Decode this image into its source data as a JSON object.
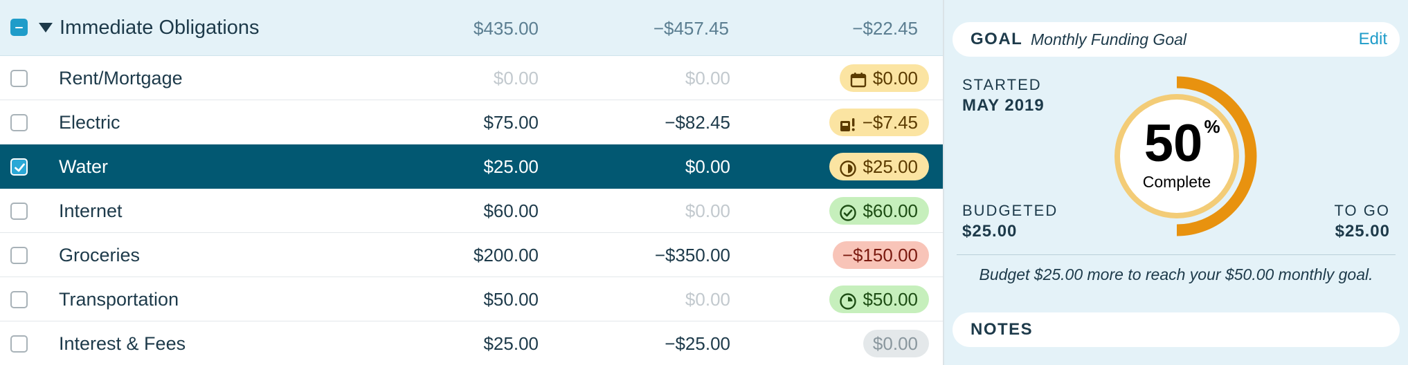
{
  "group": {
    "name": "Immediate Obligations",
    "budgeted": "$435.00",
    "activity": "−$457.45",
    "available": "−$22.45"
  },
  "rows": [
    {
      "name": "Rent/Mortgage",
      "budgeted": "$0.00",
      "activity": "$0.00",
      "available": "$0.00",
      "pill": "yellow",
      "icon": "calendar-icon",
      "checked": false
    },
    {
      "name": "Electric",
      "budgeted": "$75.00",
      "activity": "−$82.45",
      "available": "−$7.45",
      "pill": "yellow",
      "icon": "overspent-warning-icon",
      "checked": false
    },
    {
      "name": "Water",
      "budgeted": "$25.00",
      "activity": "$0.00",
      "available": "$25.00",
      "pill": "yellow",
      "icon": "half-funded-icon",
      "checked": true
    },
    {
      "name": "Internet",
      "budgeted": "$60.00",
      "activity": "$0.00",
      "available": "$60.00",
      "pill": "green",
      "icon": "check-circle-icon",
      "checked": false
    },
    {
      "name": "Groceries",
      "budgeted": "$200.00",
      "activity": "−$350.00",
      "available": "−$150.00",
      "pill": "red",
      "icon": "",
      "checked": false
    },
    {
      "name": "Transportation",
      "budgeted": "$50.00",
      "activity": "$0.00",
      "available": "$50.00",
      "pill": "green",
      "icon": "partial-progress-icon",
      "checked": false
    },
    {
      "name": "Interest & Fees",
      "budgeted": "$25.00",
      "activity": "−$25.00",
      "available": "$0.00",
      "pill": "grey",
      "icon": "",
      "checked": false
    }
  ],
  "inspector": {
    "goal_label": "GOAL",
    "goal_type": "Monthly Funding Goal",
    "edit_label": "Edit",
    "started_label": "STARTED",
    "started_value": "MAY 2019",
    "budgeted_label": "BUDGETED",
    "budgeted_value": "$25.00",
    "togo_label": "TO GO",
    "togo_value": "$25.00",
    "percent": "50",
    "percent_sign": "%",
    "complete_label": "Complete",
    "progress_fraction": 0.5,
    "message": "Budget $25.00 more to reach your $50.00 monthly goal.",
    "notes_label": "NOTES"
  },
  "colors": {
    "selected_row": "#025872",
    "accent": "#1f9cc9",
    "ring_progress": "#e8920f",
    "ring_track": "#f3cc77"
  }
}
